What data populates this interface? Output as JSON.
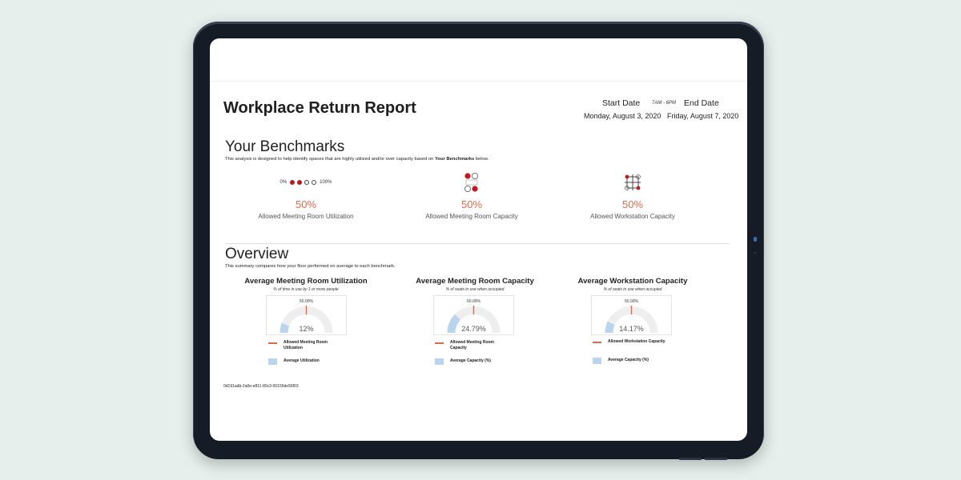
{
  "report": {
    "title": "Workplace Return Report",
    "start_label": "Start Date",
    "end_label": "End Date",
    "time_range": "7AM - 6PM",
    "start_date": "Monday, August 3, 2020",
    "end_date": "Friday, August 7, 2020"
  },
  "benchmarks": {
    "title": "Your Benchmarks",
    "desc_pre": "This analysis is designed to help identify spaces that are highly utilized and/or over capacity based on ",
    "desc_bold": "Your Benchmarks",
    "desc_post": " below.",
    "scale_min": "0%",
    "scale_max": "100%",
    "scale_filled": 2,
    "scale_total": 4,
    "items": [
      {
        "icon": "utilization-dots-icon",
        "value": "50%",
        "label": "Allowed Meeting Room Utilization"
      },
      {
        "icon": "meeting-capacity-icon",
        "value": "50%",
        "label": "Allowed Meeting Room Capacity"
      },
      {
        "icon": "workstation-grid-icon",
        "value": "50%",
        "label": "Allowed Workstation Capacity"
      }
    ]
  },
  "overview": {
    "title": "Overview",
    "desc": "This summary compares how your floor performed on average to each benchmark.",
    "cards": [
      {
        "title": "Average Meeting Room Utilization",
        "subtitle": "% of time in use by 1 or more people",
        "benchmark_label": "50.00%",
        "benchmark_fraction": 0.5,
        "value_label": "12%",
        "value_fraction": 0.12,
        "legend_line": "Allowed Meeting Room Utilization",
        "legend_box": "Average Utilization"
      },
      {
        "title": "Average Meeting Room Capacity",
        "subtitle": "% of seats in use when occupied",
        "benchmark_label": "50.00%",
        "benchmark_fraction": 0.5,
        "value_label": "24.79%",
        "value_fraction": 0.2479,
        "legend_line": "Allowed Meeting Room Capacity",
        "legend_box": "Average Capacity (%)"
      },
      {
        "title": "Average Workstation Capacity",
        "subtitle": "% of seats in use when occupied",
        "benchmark_label": "50.00%",
        "benchmark_fraction": 0.5,
        "value_label": "14.17%",
        "value_fraction": 0.1417,
        "legend_line": "Allowed Workstation Capacity",
        "legend_box": "Average Capacity (%)"
      }
    ]
  },
  "footer": {
    "id": "0d191adb-2a0e-e811-80c3-00155de56f03"
  },
  "colors": {
    "accent": "#e0694a",
    "benchmark_red": "#c0191f",
    "gauge_fill": "#b9d4ec",
    "gauge_track": "#eeeeee",
    "tablet_frame": "#161c26",
    "background": "#e6efec"
  }
}
